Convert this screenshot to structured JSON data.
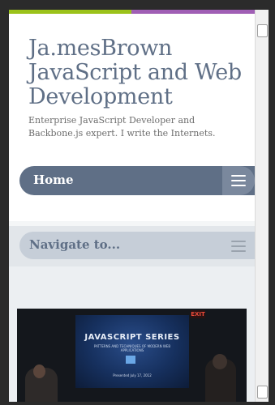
{
  "header": {
    "site_title": "Ja.mesBrown JavaScript and Web Development",
    "description": "Enterprise JavaScript Developer and Backbone.js expert. I write the Internets."
  },
  "nav": {
    "primary_label": "Home",
    "secondary_label": "Navigate to..."
  },
  "photo": {
    "screen_title": "JAVASCRIPT SERIES",
    "screen_subtitle": "PATTERNS AND TECHNIQUES OF MODERN WEB APPLICATIONS",
    "screen_date": "Presented July 17, 2012",
    "exit_sign": "EXIT"
  },
  "colors": {
    "accent_green": "#9bc21a",
    "accent_purple": "#a05fb5",
    "nav_blue": "#5f6f86"
  },
  "icons": {
    "nav_toggle": "menu-icon",
    "nav2_toggle": "menu-icon"
  }
}
